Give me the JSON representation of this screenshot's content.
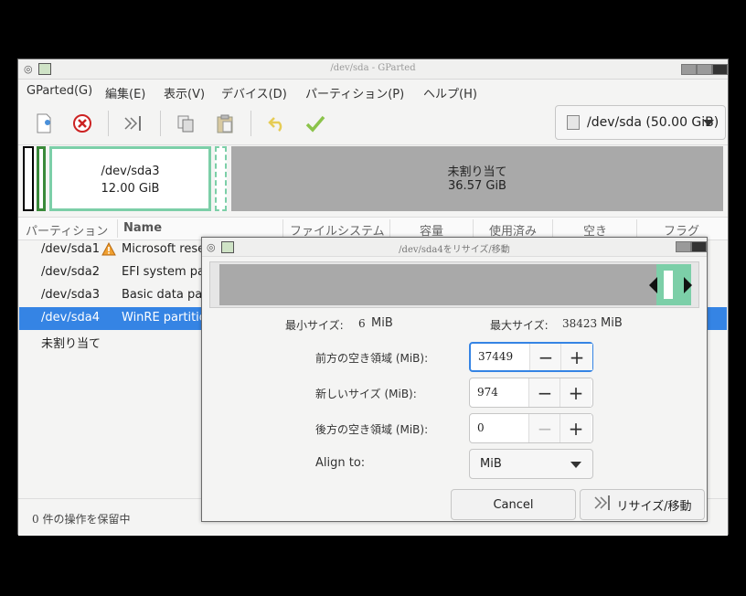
{
  "main_window": {
    "title": "/dev/sda - GParted",
    "menu": [
      "GParted(G)",
      "編集(E)",
      "表示(V)",
      "デバイス(D)",
      "パーティション(P)",
      "ヘルプ(H)"
    ],
    "device": "/dev/sda (50.00 GiB)",
    "partition_bar": {
      "sda3": {
        "name": "/dev/sda3",
        "size": "12.00 GiB"
      },
      "unallocated": {
        "name": "未割り当て",
        "size": "36.57 GiB"
      }
    },
    "columns": [
      "パーティション",
      "Name",
      "ファイルシステム",
      "容量",
      "使用済み",
      "空き",
      "フラグ"
    ],
    "rows": [
      {
        "partition": "/dev/sda1",
        "name": "Microsoft rese",
        "warning": true
      },
      {
        "partition": "/dev/sda2",
        "name": "EFI system par"
      },
      {
        "partition": "/dev/sda3",
        "name": "Basic data part"
      },
      {
        "partition": "/dev/sda4",
        "name": "WinRE partitio",
        "selected": true
      },
      {
        "partition": "未割り当て",
        "name": ""
      }
    ],
    "status": "0 件の操作を保留中"
  },
  "dialog": {
    "title": "/dev/sda4をリサイズ/移動",
    "min_size_label": "最小サイズ:",
    "min_size_value": "6",
    "min_size_unit": "MiB",
    "max_size_label": "最大サイズ:",
    "max_size_value": "38423",
    "max_size_unit": "MiB",
    "free_before_label": "前方の空き領域 (MiB):",
    "free_before_value": "37449",
    "new_size_label": "新しいサイズ (MiB):",
    "new_size_value": "974",
    "free_after_label": "後方の空き領域 (MiB):",
    "free_after_value": "0",
    "align_label": "Align to:",
    "align_value": "MiB",
    "cancel": "Cancel",
    "resize": "リサイズ/移動"
  },
  "colors": {
    "partition_border": "#7ccfa8",
    "selection": "#3584e4",
    "unallocated": "#a9a9a9"
  }
}
